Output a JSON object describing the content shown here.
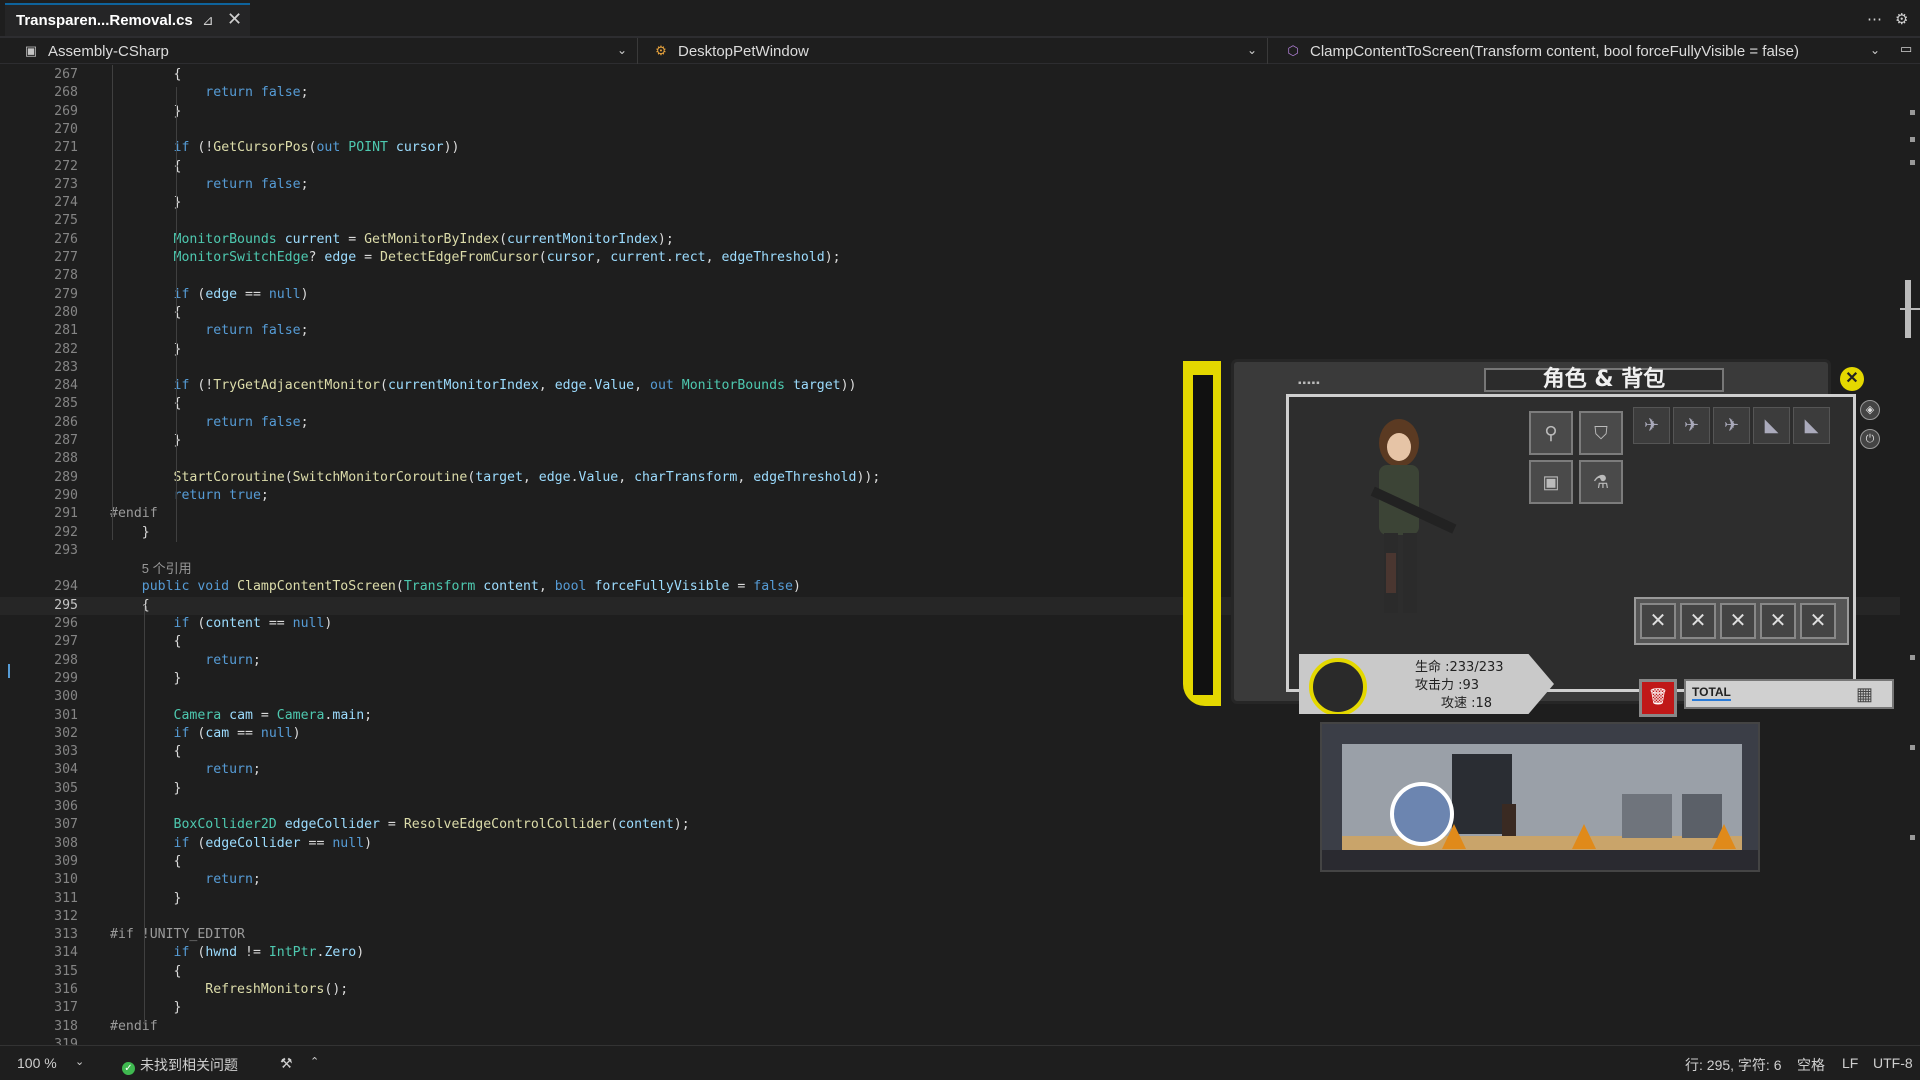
{
  "tab": {
    "title": "Transparen...Removal.cs",
    "pin": "⊿",
    "close": "✕"
  },
  "tabbar_right": {
    "more": "⋯",
    "settings": "⚙"
  },
  "nav": {
    "project": "Assembly-CSharp",
    "class": "DesktopPetWindow",
    "member": "ClampContentToScreen(Transform content, bool forceFullyVisible = false)"
  },
  "code_lines": [
    {
      "n": "267",
      "h": "        {"
    },
    {
      "n": "268",
      "h": "            <span class=\"kw\">return</span> <span class=\"kw\">false</span>;"
    },
    {
      "n": "269",
      "h": "        }"
    },
    {
      "n": "270",
      "h": ""
    },
    {
      "n": "271",
      "h": "        <span class=\"kw\">if</span> (!<span class=\"fn\">GetCursorPos</span>(<span class=\"kw\">out</span> <span class=\"ty\">POINT</span> <span class=\"va\">cursor</span>))"
    },
    {
      "n": "272",
      "h": "        {"
    },
    {
      "n": "273",
      "h": "            <span class=\"kw\">return</span> <span class=\"kw\">false</span>;"
    },
    {
      "n": "274",
      "h": "        }"
    },
    {
      "n": "275",
      "h": ""
    },
    {
      "n": "276",
      "h": "        <span class=\"ty\">MonitorBounds</span> <span class=\"va\">current</span> = <span class=\"fn\">GetMonitorByIndex</span>(<span class=\"va\">currentMonitorIndex</span>);"
    },
    {
      "n": "277",
      "h": "        <span class=\"ty\">MonitorSwitchEdge</span>? <span class=\"va\">edge</span> = <span class=\"fn\">DetectEdgeFromCursor</span>(<span class=\"va\">cursor</span>, <span class=\"va\">current</span>.<span class=\"va\">rect</span>, <span class=\"va\">edgeThreshold</span>);"
    },
    {
      "n": "278",
      "h": ""
    },
    {
      "n": "279",
      "h": "        <span class=\"kw\">if</span> (<span class=\"va\">edge</span> == <span class=\"kw\">null</span>)"
    },
    {
      "n": "280",
      "h": "        {"
    },
    {
      "n": "281",
      "h": "            <span class=\"kw\">return</span> <span class=\"kw\">false</span>;"
    },
    {
      "n": "282",
      "h": "        }"
    },
    {
      "n": "283",
      "h": ""
    },
    {
      "n": "284",
      "h": "        <span class=\"kw\">if</span> (!<span class=\"fn\">TryGetAdjacentMonitor</span>(<span class=\"va\">currentMonitorIndex</span>, <span class=\"va\">edge</span>.<span class=\"va\">Value</span>, <span class=\"kw\">out</span> <span class=\"ty\">MonitorBounds</span> <span class=\"va\">target</span>))"
    },
    {
      "n": "285",
      "h": "        {"
    },
    {
      "n": "286",
      "h": "            <span class=\"kw\">return</span> <span class=\"kw\">false</span>;"
    },
    {
      "n": "287",
      "h": "        }"
    },
    {
      "n": "288",
      "h": ""
    },
    {
      "n": "289",
      "h": "        <span class=\"fn\">StartCoroutine</span>(<span class=\"fn\">SwitchMonitorCoroutine</span>(<span class=\"va\">target</span>, <span class=\"va\">edge</span>.<span class=\"va\">Value</span>, <span class=\"va\">charTransform</span>, <span class=\"va\">edgeThreshold</span>));"
    },
    {
      "n": "290",
      "h": "        <span class=\"kw\">return</span> <span class=\"kw\">true</span>;"
    },
    {
      "n": "291",
      "h": "<span class=\"pp\">#endif</span>"
    },
    {
      "n": "292",
      "h": "    }"
    },
    {
      "n": "293",
      "h": ""
    },
    {
      "n": "",
      "h": "    <span class=\"ref\">5 个引用</span>"
    },
    {
      "n": "294",
      "h": "    <span class=\"kw\">public</span> <span class=\"kw\">void</span> <span class=\"fn\">ClampContentToScreen</span>(<span class=\"ty\">Transform</span> <span class=\"va\">content</span>, <span class=\"kw\">bool</span> <span class=\"va\">forceFullyVisible</span> = <span class=\"kw\">false</span>)"
    },
    {
      "n": "295",
      "h": "    {",
      "cur": true
    },
    {
      "n": "296",
      "h": "        <span class=\"kw\">if</span> (<span class=\"va\">content</span> == <span class=\"kw\">null</span>)"
    },
    {
      "n": "297",
      "h": "        {"
    },
    {
      "n": "298",
      "h": "            <span class=\"kw\">return</span>;"
    },
    {
      "n": "299",
      "h": "        }"
    },
    {
      "n": "300",
      "h": ""
    },
    {
      "n": "301",
      "h": "        <span class=\"ty\">Camera</span> <span class=\"va\">cam</span> = <span class=\"ty\">Camera</span>.<span class=\"va\">main</span>;"
    },
    {
      "n": "302",
      "h": "        <span class=\"kw\">if</span> (<span class=\"va\">cam</span> == <span class=\"kw\">null</span>)"
    },
    {
      "n": "303",
      "h": "        {"
    },
    {
      "n": "304",
      "h": "            <span class=\"kw\">return</span>;"
    },
    {
      "n": "305",
      "h": "        }"
    },
    {
      "n": "306",
      "h": ""
    },
    {
      "n": "307",
      "h": "        <span class=\"ty\">BoxCollider2D</span> <span class=\"va\">edgeCollider</span> = <span class=\"fn\">ResolveEdgeControlCollider</span>(<span class=\"va\">content</span>);"
    },
    {
      "n": "308",
      "h": "        <span class=\"kw\">if</span> (<span class=\"va\">edgeCollider</span> == <span class=\"kw\">null</span>)"
    },
    {
      "n": "309",
      "h": "        {"
    },
    {
      "n": "310",
      "h": "            <span class=\"kw\">return</span>;"
    },
    {
      "n": "311",
      "h": "        }"
    },
    {
      "n": "312",
      "h": ""
    },
    {
      "n": "313",
      "h": "<span class=\"pp\">#if !UNITY_EDITOR</span>"
    },
    {
      "n": "314",
      "h": "        <span class=\"kw\">if</span> (<span class=\"va\">hwnd</span> != <span class=\"ty\">IntPtr</span>.<span class=\"va\">Zero</span>)"
    },
    {
      "n": "315",
      "h": "        {"
    },
    {
      "n": "316",
      "h": "            <span class=\"fn\">RefreshMonitors</span>();"
    },
    {
      "n": "317",
      "h": "        }"
    },
    {
      "n": "318",
      "h": "<span class=\"pp\">#endif</span>"
    },
    {
      "n": "319",
      "h": ""
    }
  ],
  "pet": {
    "title": "角色 & 背包",
    "dots": "▪▪▪▪▪",
    "close": "✕",
    "hp": "生命 :233/233",
    "atk": "攻击力 :93",
    "spd": "攻速 :18",
    "total_label": "TOTAL",
    "equip_icons": [
      "wrench-icon",
      "shield-icon",
      "backpack-icon",
      "flask-icon"
    ],
    "weapon_icons": [
      "jet-icon",
      "jet-icon",
      "jet-icon",
      "boot-icon",
      "boot-icon"
    ],
    "slot_x": "✕"
  },
  "status": {
    "zoom": "100 %",
    "issues": "未找到相关问题",
    "position": "行: 295, 字符: 6",
    "indent": "空格",
    "eol": "LF",
    "encoding": "UTF-8"
  }
}
